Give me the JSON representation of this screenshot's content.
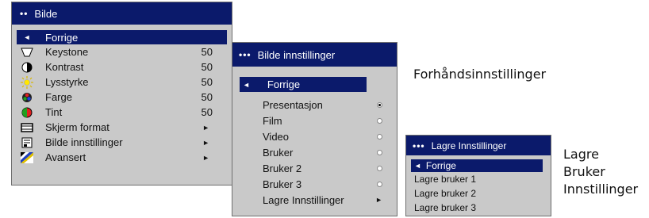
{
  "menu1": {
    "title": "Bilde",
    "back": "Forrige",
    "items": [
      {
        "label": "Keystone",
        "value": "50",
        "icon": "keystone-icon"
      },
      {
        "label": "Kontrast",
        "value": "50",
        "icon": "contrast-icon"
      },
      {
        "label": "Lysstyrke",
        "value": "50",
        "icon": "brightness-icon"
      },
      {
        "label": "Farge",
        "value": "50",
        "icon": "color-icon"
      },
      {
        "label": "Tint",
        "value": "50",
        "icon": "tint-icon"
      },
      {
        "label": "Skjerm format",
        "value": "►",
        "icon": "screen-format-icon"
      },
      {
        "label": "Bilde innstillinger",
        "value": "►",
        "icon": "picture-settings-icon"
      },
      {
        "label": "Avansert",
        "value": "►",
        "icon": "advanced-icon"
      }
    ]
  },
  "menu2": {
    "title": "Bilde innstillinger",
    "back": "Forrige",
    "items": [
      {
        "label": "Presentasjon",
        "selected": true
      },
      {
        "label": "Film",
        "selected": false
      },
      {
        "label": "Video",
        "selected": false
      },
      {
        "label": "Bruker",
        "selected": false
      },
      {
        "label": "Bruker 2",
        "selected": false
      },
      {
        "label": "Bruker 3",
        "selected": false
      },
      {
        "label": "Lagre Innstillinger",
        "arrow": "►"
      }
    ]
  },
  "menu3": {
    "title": "Lagre Innstillinger",
    "back": "Forrige",
    "items": [
      "Lagre bruker 1",
      "Lagre bruker 2",
      "Lagre bruker 3"
    ]
  },
  "annotations": {
    "presets": "Forhåndsinnstillinger",
    "save_line1": "Lagre",
    "save_line2": "Bruker",
    "save_line3": "Innstillinger"
  },
  "colors": {
    "title_bg": "#0b1a6b",
    "menu_bg": "#c9c9c9"
  }
}
